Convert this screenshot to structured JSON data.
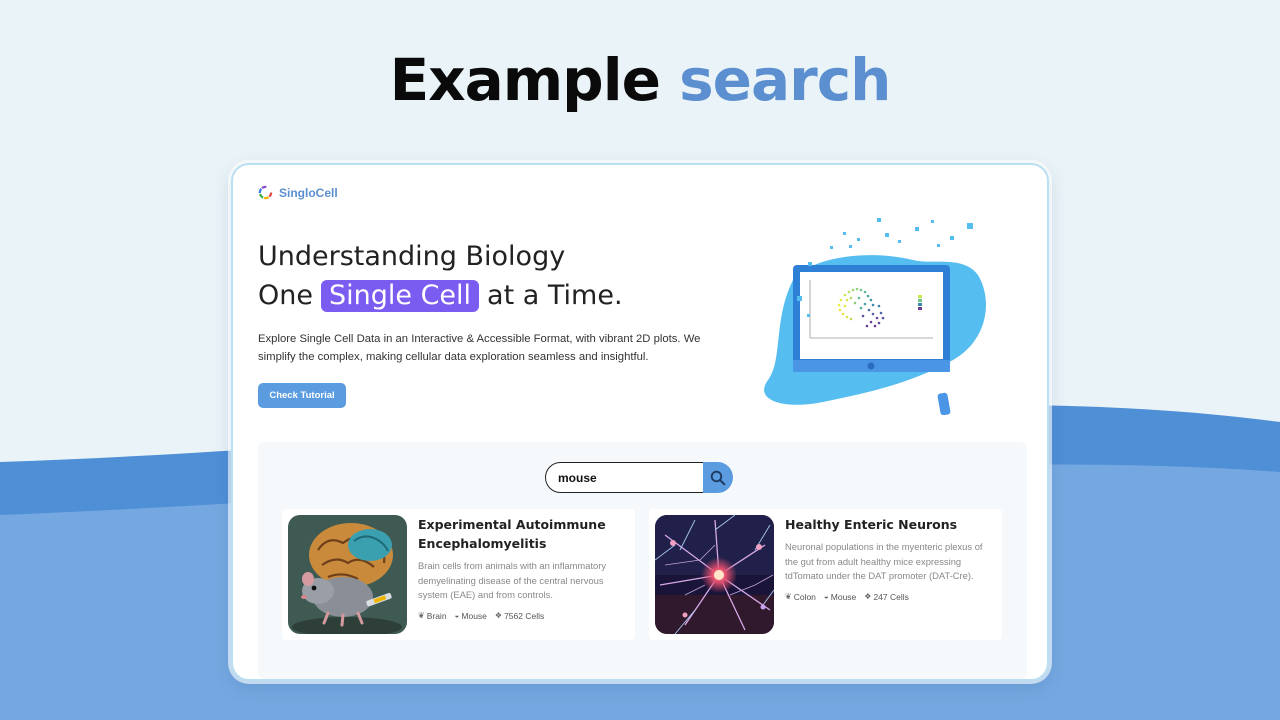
{
  "headline": {
    "main": "Example",
    "accent": "search"
  },
  "app": {
    "brand": "SingloCell",
    "hero": {
      "line1": "Understanding Biology",
      "line2_before": "One",
      "line2_highlight": "Single Cell",
      "line2_after": "at a Time.",
      "description": "Explore Single Cell Data in an Interactive & Accessible Format, with vibrant 2D plots. We simplify the complex, making cellular data exploration seamless and insightful.",
      "button": "Check Tutorial"
    },
    "search": {
      "value": "mouse",
      "icon": "search-icon"
    },
    "results": [
      {
        "title": "Experimental Autoimmune Encephalomyelitis",
        "description": "Brain cells from animals with an inflammatory demyelinating disease of the central nervous system (EAE) and from controls.",
        "tissue": "Brain",
        "species": "Mouse",
        "cells": "7562 Cells"
      },
      {
        "title": "Healthy Enteric Neurons",
        "description": "Neuronal populations in the myenteric plexus of the gut from adult healthy mice expressing tdTomato under the DAT promoter (DAT-Cre).",
        "tissue": "Colon",
        "species": "Mouse",
        "cells": "247 Cells"
      }
    ]
  },
  "colors": {
    "accent_blue": "#5b8fd0",
    "highlight_purple": "#7b5cf0",
    "button_blue": "#5b9be0",
    "wave_dark": "#4f8fd6",
    "wave_light": "#75a8e0"
  }
}
